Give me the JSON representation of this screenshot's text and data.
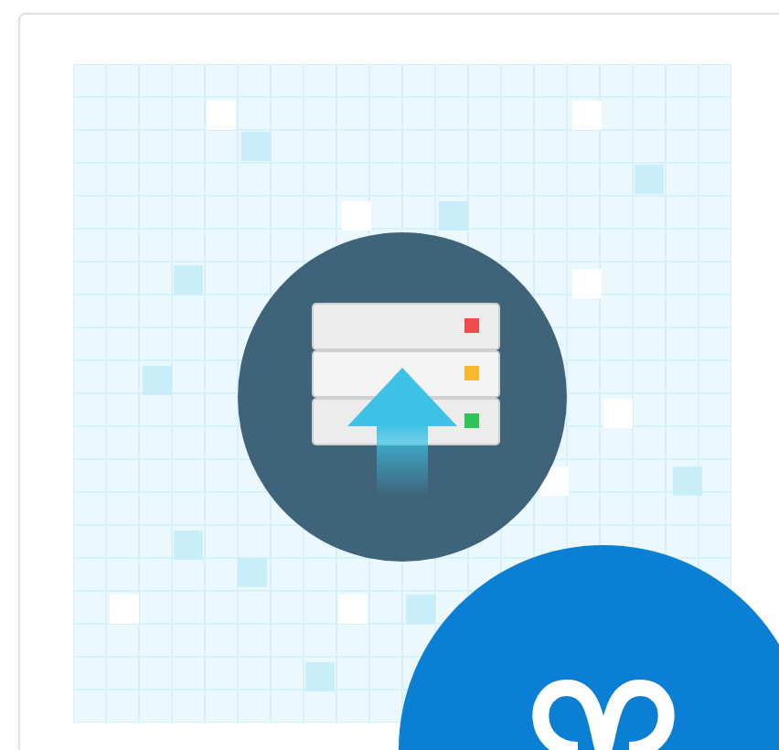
{
  "illustration": {
    "server_lights": [
      {
        "color": "#f04a4a"
      },
      {
        "color": "#f5b82e"
      },
      {
        "color": "#2fc45a"
      }
    ]
  }
}
